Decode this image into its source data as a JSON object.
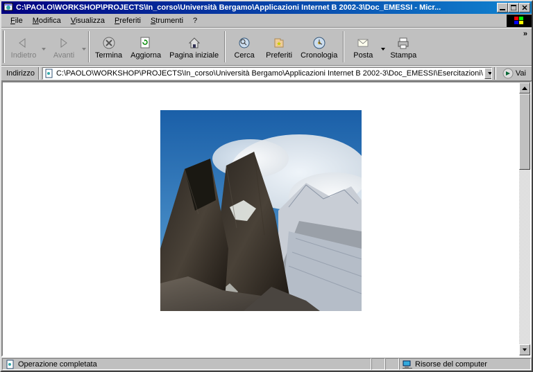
{
  "titlebar": {
    "title": "C:\\PAOLO\\WORKSHOP\\PROJECTS\\In_corso\\Università Bergamo\\Applicazioni Internet B 2002-3\\Doc_EMESSI - Micr..."
  },
  "menubar": {
    "file": "File",
    "modifica": "Modifica",
    "visualizza": "Visualizza",
    "preferiti": "Preferiti",
    "strumenti": "Strumenti",
    "help": "?"
  },
  "toolbar": {
    "back": "Indietro",
    "forward": "Avanti",
    "stop": "Termina",
    "refresh": "Aggiorna",
    "home": "Pagina iniziale",
    "search": "Cerca",
    "favorites": "Preferiti",
    "history": "Cronologia",
    "mail": "Posta",
    "print": "Stampa",
    "overflow": "»"
  },
  "addressbar": {
    "label": "Indirizzo",
    "value": "C:\\PAOLO\\WORKSHOP\\PROJECTS\\In_corso\\Università Bergamo\\Applicazioni Internet B 2002-3\\Doc_EMESSI\\Esercitazioni\\",
    "go": "Vai"
  },
  "statusbar": {
    "status": "Operazione completata",
    "zone": "Risorse del computer"
  }
}
